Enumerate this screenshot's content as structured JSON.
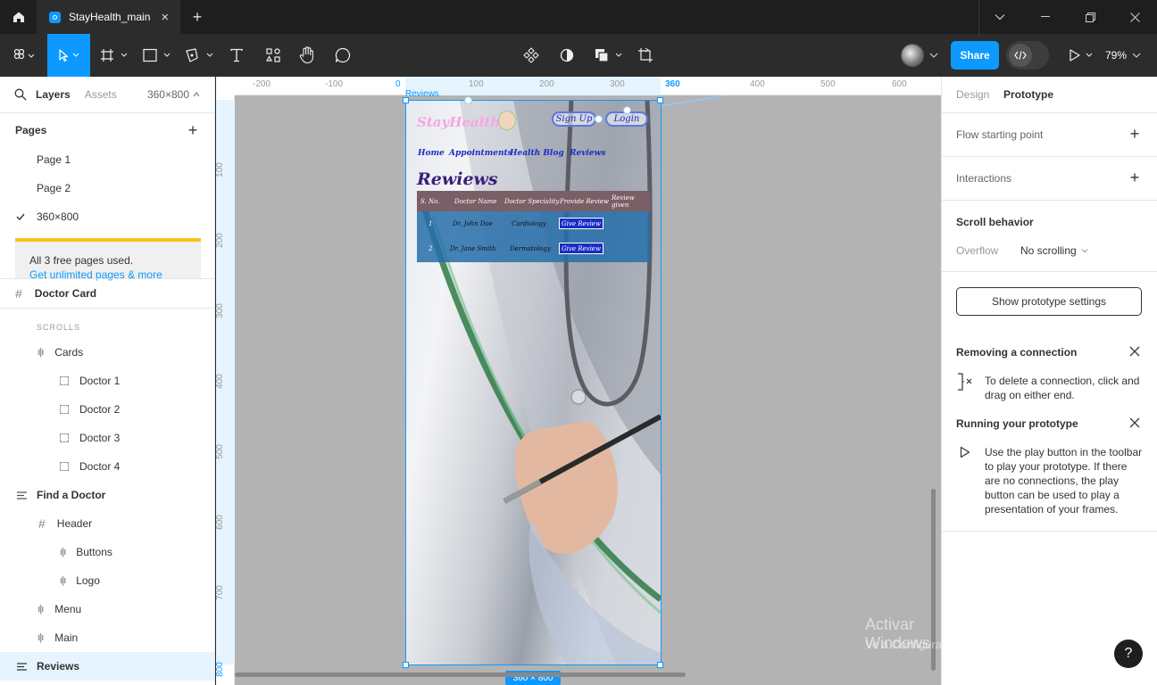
{
  "titlebar": {
    "tab_title": "StayHealth_main"
  },
  "toolbar": {
    "share_label": "Share",
    "zoom_label": "79%"
  },
  "left_panel": {
    "tabs": {
      "layers": "Layers",
      "assets": "Assets",
      "frame_size": "360×800"
    },
    "pages_header": "Pages",
    "pages": [
      {
        "label": "Page 1"
      },
      {
        "label": "Page 2"
      },
      {
        "label": "360×800"
      }
    ],
    "limit": {
      "notice": "All 3 free pages used.",
      "link": "Get unlimited pages & more"
    },
    "layers": [
      {
        "label": "Doctor Card"
      },
      {
        "label": "SCROLLS"
      },
      {
        "label": "Cards"
      },
      {
        "label": "Doctor 1"
      },
      {
        "label": "Doctor 2"
      },
      {
        "label": "Doctor 3"
      },
      {
        "label": "Doctor 4"
      },
      {
        "label": "Find a Doctor"
      },
      {
        "label": "Header"
      },
      {
        "label": "Buttons"
      },
      {
        "label": "Logo"
      },
      {
        "label": "Menu"
      },
      {
        "label": "Main"
      },
      {
        "label": "Reviews"
      }
    ]
  },
  "canvas": {
    "ruler_h": [
      "-200",
      "-100",
      "0",
      "100",
      "200",
      "300",
      "360",
      "400",
      "500",
      "600",
      "700"
    ],
    "ruler_v": [
      "100",
      "200",
      "300",
      "400",
      "500",
      "600",
      "700",
      "800"
    ],
    "frame_badge": "360 × 800",
    "frame_name": "Reviews",
    "watermark": {
      "line1": "Activar Windows",
      "line2": "Ve a Configuración para activar Windows."
    }
  },
  "mockup": {
    "logo": "StayHealthy",
    "buttons": {
      "signup": "Sign Up",
      "login": "Login"
    },
    "nav": [
      "Home",
      "Appointments",
      "Health Blog",
      "Reviews"
    ],
    "heading": "Rewiews",
    "table": {
      "headers": [
        "S. No.",
        "Doctor Name",
        "Doctor Speciality",
        "Provide Review",
        "Review given"
      ],
      "rows": [
        {
          "num": "1",
          "name": "Dr. John Doe",
          "spec": "Cardiology",
          "action": "Give Review"
        },
        {
          "num": "2",
          "name": "Dr. Jane Smith",
          "spec": "Dermatology",
          "action": "Give Review"
        }
      ]
    }
  },
  "right_panel": {
    "tabs": {
      "design": "Design",
      "prototype": "Prototype"
    },
    "flow_label": "Flow starting point",
    "interactions_label": "Interactions",
    "scroll_title": "Scroll behavior",
    "overflow_label": "Overflow",
    "overflow_value": "No scrolling",
    "settings_button": "Show prototype settings",
    "tips": [
      {
        "title": "Removing a connection",
        "body": "To delete a connection, click and drag on either end."
      },
      {
        "title": "Running your prototype",
        "body": "Use the play button in the toolbar to play your prototype. If there are no connections, the play button can be used to play a presentation of your frames."
      }
    ]
  },
  "help_label": "?",
  "colors": {
    "accent": "#0d99ff",
    "selection": "#e5f4ff",
    "limit_bar": "#ffc21a",
    "dark_bg": "#2c2c2c",
    "logo_pink": "#f5a6e6",
    "nav_blue": "#1a2dc4"
  }
}
